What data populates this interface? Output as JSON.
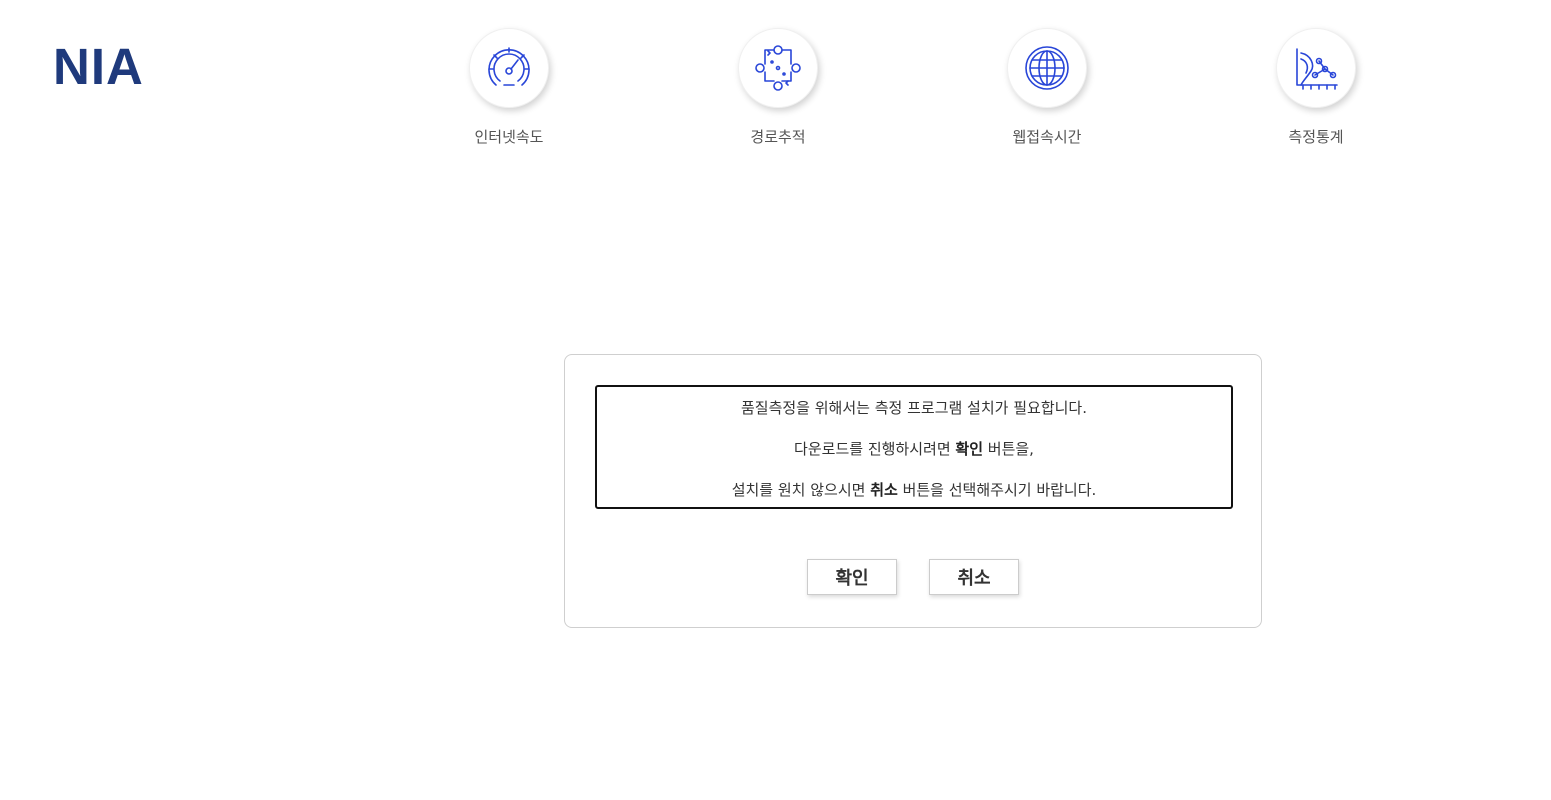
{
  "header": {
    "logo_text": "NIA",
    "logo_color": "#1f3a7c"
  },
  "nav": {
    "icon_color": "#2946d8",
    "items": [
      {
        "label": "인터넷속도",
        "icon": "speedometer-icon"
      },
      {
        "label": "경로추적",
        "icon": "route-trace-icon"
      },
      {
        "label": "웹접속시간",
        "icon": "globe-icon"
      },
      {
        "label": "측정통계",
        "icon": "statistics-icon"
      }
    ]
  },
  "dialog": {
    "message": {
      "line1": "품질측정을 위해서는 측정 프로그램 설치가 필요합니다.",
      "line2_prefix": "다운로드를 진행하시려면 ",
      "line2_bold": "확인",
      "line2_suffix": " 버튼을,",
      "line3_prefix": "설치를 원치 않으시면 ",
      "line3_bold": "취소",
      "line3_suffix": " 버튼을 선택해주시기 바랍니다."
    },
    "confirm_label": "확인",
    "cancel_label": "취소"
  }
}
